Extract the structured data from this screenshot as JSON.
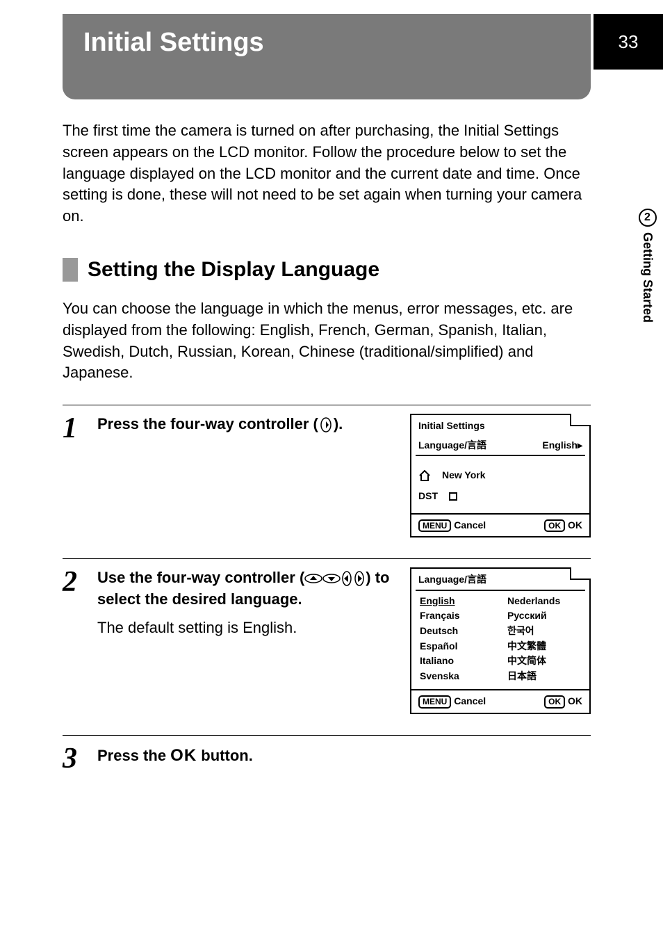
{
  "page_number": "33",
  "side_tab": {
    "chapter_number": "2",
    "label": "Getting Started"
  },
  "title": "Initial Settings",
  "intro": "The first time the camera is turned on after purchasing, the Initial Settings screen appears on the LCD monitor. Follow the procedure below to set the language displayed on the LCD monitor and the current date and time. Once setting is done, these will not need to be set again when turning your camera on.",
  "section_heading": "Setting the Display Language",
  "section_intro": "You can choose the language in which the menus, error messages, etc. are displayed from the following: English, French, German, Spanish, Italian, Swedish, Dutch, Russian, Korean, Chinese (traditional/simplified) and Japanese.",
  "steps": {
    "s1": {
      "num": "1",
      "text_a": "Press the four-way controller (",
      "text_b": ")."
    },
    "s2": {
      "num": "2",
      "text_a": "Use the four-way controller (",
      "text_b": ") to select the desired language.",
      "sub": "The default setting is English."
    },
    "s3": {
      "num": "3",
      "text_a": "Press the ",
      "text_b": " button."
    }
  },
  "lcd1": {
    "title": "Initial Settings",
    "lang_label": "Language/言語",
    "lang_value": "English",
    "city": "New York",
    "dst_label": "DST",
    "menu_label": "MENU",
    "cancel_label": "Cancel",
    "ok_pill": "OK",
    "ok_label": "OK"
  },
  "lcd2": {
    "title": "Language/言語",
    "col1": [
      "English",
      "Français",
      "Deutsch",
      "Español",
      "Italiano",
      "Svenska"
    ],
    "col2": [
      "Nederlands",
      "Русский",
      "한국어",
      "中文繁體",
      "中文简体",
      "日本語"
    ],
    "menu_label": "MENU",
    "cancel_label": "Cancel",
    "ok_pill": "OK",
    "ok_label": "OK"
  },
  "ok_button_glyph": "OK"
}
